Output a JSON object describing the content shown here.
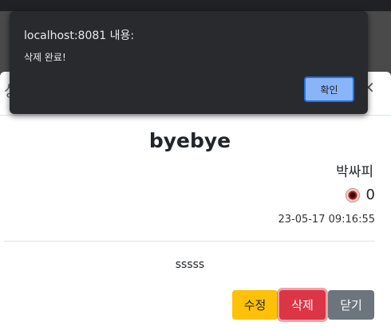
{
  "alert": {
    "origin": "localhost:8081 내용:",
    "message": "삭제 완료!",
    "ok_label": "확인"
  },
  "modal": {
    "header_title": "상",
    "close_symbol": "×"
  },
  "post": {
    "title": "byebye",
    "author": "박싸피",
    "views": "0",
    "date": "23-05-17 09:16:55",
    "content": "sssss"
  },
  "buttons": {
    "edit": "수정",
    "delete": "삭제",
    "close": "닫기"
  },
  "colors": {
    "edit": "#ffc107",
    "delete": "#dc3545",
    "close": "#6c757d",
    "alert_bg": "#292a2d",
    "alert_button": "#8ab4f8"
  }
}
